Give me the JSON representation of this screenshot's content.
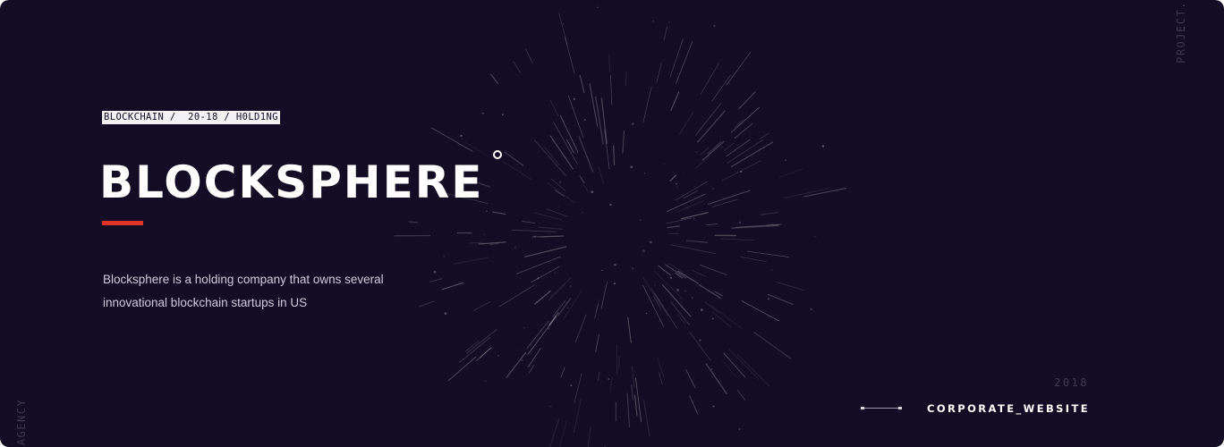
{
  "hero": {
    "tagline": "BLOCKCHAIN /  20-18 / H0LD1NG",
    "title": "BLOCKSPHERE",
    "description_lines": [
      "Blocksphere is a holding company that owns several",
      "innovational blockchain startups in US"
    ],
    "accent_color": "#e0342a",
    "background_color": "#120c24"
  },
  "side_labels": {
    "right": "PROJECT.",
    "left": "AGENCY"
  },
  "footer": {
    "year": "2018",
    "link_label": "CORPORATE_WEBSITE"
  },
  "decor": {
    "ring_icon": "circle-outline-icon",
    "background_art": "particle-burst"
  }
}
